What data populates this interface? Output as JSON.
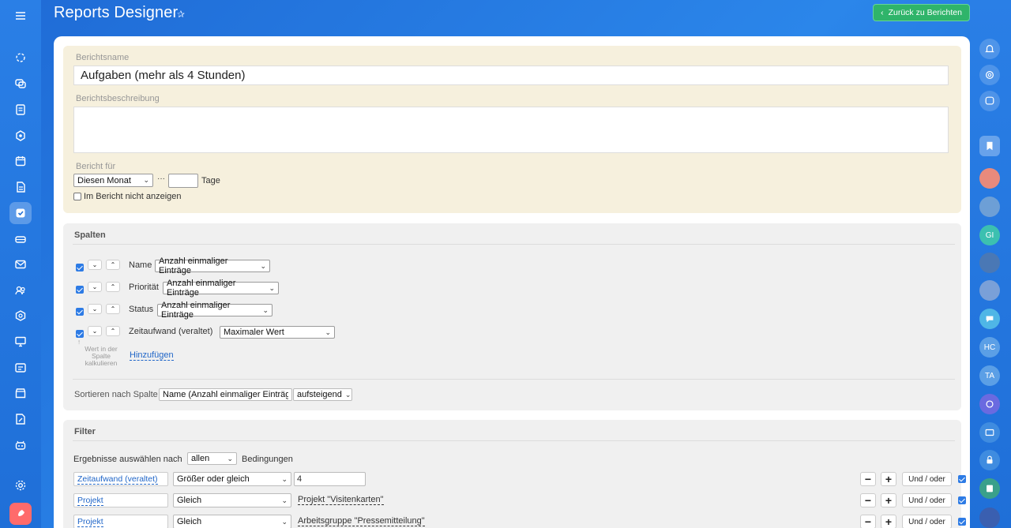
{
  "header": {
    "title": "Reports Designer",
    "back_button": "Zurück zu Berichten"
  },
  "report": {
    "name_label": "Berichtsname",
    "name_value": "Aufgaben (mehr als 4 Stunden)",
    "description_label": "Berichtsbeschreibung",
    "description_value": "",
    "period_label": "Bericht für",
    "period_value": "Diesen Monat",
    "period_ellipsis": "···",
    "days_value": "",
    "days_label": "Tage",
    "hide_label": "Im Bericht nicht anzeigen"
  },
  "columns": {
    "title": "Spalten",
    "rows": [
      {
        "checked": true,
        "name": "Name",
        "agg": "Anzahl einmaliger Einträge"
      },
      {
        "checked": true,
        "name": "Priorität",
        "agg": "Anzahl einmaliger Einträge"
      },
      {
        "checked": true,
        "name": "Status",
        "agg": "Anzahl einmaliger Einträge"
      },
      {
        "checked": true,
        "name": "Zeitaufwand (veraltet)",
        "agg": "Maximaler Wert"
      }
    ],
    "hint": "Wert in der Spalte kalkulieren",
    "add_link": "Hinzufügen",
    "sort_label": "Sortieren nach Spalte",
    "sort_column": "Name (Anzahl einmaliger Einträge",
    "sort_order": "aufsteigend"
  },
  "filter": {
    "title": "Filter",
    "select_prefix": "Ergebnisse auswählen nach",
    "select_value": "allen",
    "select_suffix": "Bedingungen",
    "rows": [
      {
        "field": "Zeitaufwand (veraltet)",
        "op": "Größer oder gleich",
        "value": "4",
        "value_is_input": true
      },
      {
        "field": "Projekt",
        "op": "Gleich",
        "value": "Projekt \"Visitenkarten\"",
        "value_is_input": false
      },
      {
        "field": "Projekt",
        "op": "Gleich",
        "value": "Arbeitsgruppe \"Pressemitteilung\"",
        "value_is_input": false
      }
    ],
    "minus": "−",
    "plus": "+",
    "und_oder": "Und / oder"
  },
  "right_sidebar": {
    "avatars": [
      "GI",
      "HC",
      "TA"
    ]
  },
  "colors": {
    "accent_blue": "#2d7be5",
    "green_button": "#2fb46a",
    "name_section_bg": "#f6f0dd"
  }
}
